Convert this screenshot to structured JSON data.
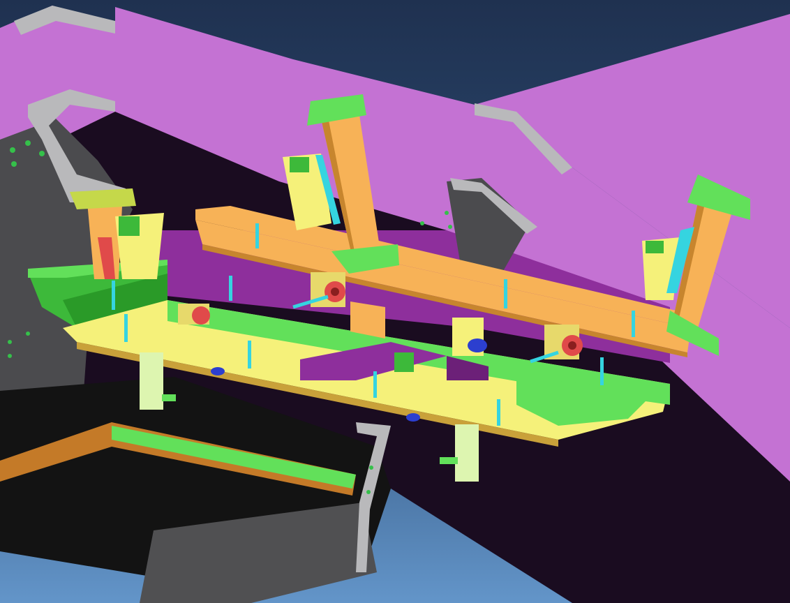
{
  "scene": {
    "kind": "cad-render",
    "subject": "bridge-girder-formwork-traveler",
    "colors": {
      "sky_top": "#1f3150",
      "sky_bottom": "#5a8cc4",
      "deck_top": "#c472d3",
      "deck_face": "#8c2f9a",
      "girder_dark": "#141014",
      "girder_grey": "#4a4a4c",
      "girder_edge": "#b9b9bb",
      "beam_orange": "#f7b257",
      "beam_orange_side": "#c7852e",
      "frame_yellow": "#f5f17a",
      "frame_green": "#62e05a",
      "frame_green_dark": "#2c9a2a",
      "stiffener_cyan": "#35d4e0",
      "bearing_red": "#e04a4a",
      "bearing_blue": "#2c3fcf",
      "post_pale_green": "#ddf5b0"
    }
  }
}
